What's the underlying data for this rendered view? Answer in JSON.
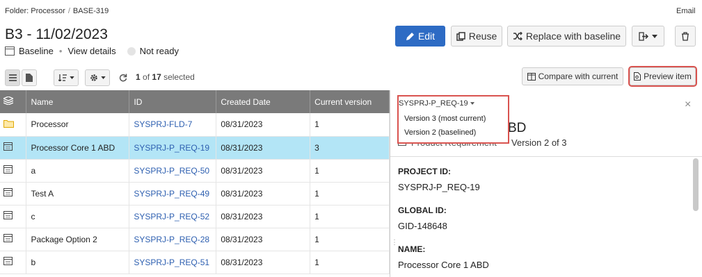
{
  "breadcrumb": {
    "folder": "Folder: Processor",
    "item": "BASE-319"
  },
  "top_right": {
    "email": "Email"
  },
  "header": {
    "title": "B3 - 11/02/2023",
    "baseline": "Baseline",
    "view_details": "View details",
    "status": "Not ready"
  },
  "actions": {
    "edit": "Edit",
    "reuse": "Reuse",
    "replace": "Replace with baseline"
  },
  "toolbar": {
    "selected_count": "1",
    "selected_total": "17",
    "selected_prefix": "of",
    "selected_suffix": "selected",
    "compare": "Compare with current",
    "preview": "Preview item"
  },
  "table": {
    "columns": [
      "Name",
      "ID",
      "Created Date",
      "Current version"
    ],
    "rows": [
      {
        "name": "Processor",
        "id": "SYSPRJ-FLD-7",
        "date": "08/31/2023",
        "version": "1",
        "icon": "folder-icon"
      },
      {
        "name": "Processor Core 1 ABD",
        "id": "SYSPRJ-P_REQ-19",
        "date": "08/31/2023",
        "version": "3",
        "icon": "requirement-icon"
      },
      {
        "name": "a",
        "id": "SYSPRJ-P_REQ-50",
        "date": "08/31/2023",
        "version": "1",
        "icon": "requirement-icon"
      },
      {
        "name": "Test A",
        "id": "SYSPRJ-P_REQ-49",
        "date": "08/31/2023",
        "version": "1",
        "icon": "requirement-icon"
      },
      {
        "name": "c",
        "id": "SYSPRJ-P_REQ-52",
        "date": "08/31/2023",
        "version": "1",
        "icon": "requirement-icon"
      },
      {
        "name": "Package Option 2",
        "id": "SYSPRJ-P_REQ-28",
        "date": "08/31/2023",
        "version": "1",
        "icon": "requirement-icon"
      },
      {
        "name": "b",
        "id": "SYSPRJ-P_REQ-51",
        "date": "08/31/2023",
        "version": "1",
        "icon": "requirement-icon"
      }
    ]
  },
  "preview": {
    "selector": "SYSPRJ-P_REQ-19",
    "options": [
      "Version 3 (most current)",
      "Version 2 (baselined)"
    ],
    "title_fragment": "BD",
    "type": "Product Requirement",
    "version": "Version 2 of 3",
    "fields": [
      {
        "label": "PROJECT ID:",
        "value": "SYSPRJ-P_REQ-19"
      },
      {
        "label": "GLOBAL ID:",
        "value": "GID-148648"
      },
      {
        "label": "NAME:",
        "value": "Processor Core 1 ABD"
      }
    ]
  },
  "colors": {
    "primary": "#2d6bc4",
    "highlight": "#b3e5f6",
    "callout": "#d9534f",
    "header": "#7a7a7a",
    "link": "#2d5fb0"
  }
}
